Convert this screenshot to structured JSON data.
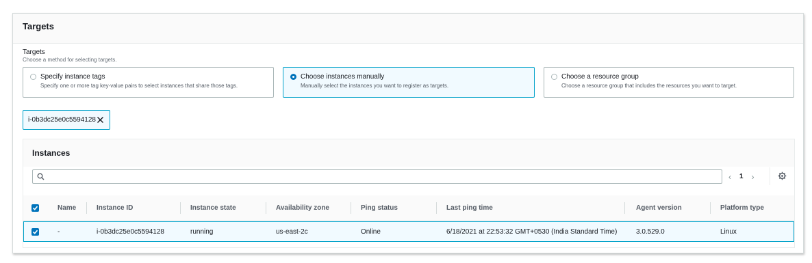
{
  "panel": {
    "title": "Targets"
  },
  "targets_field": {
    "label": "Targets",
    "description": "Choose a method for selecting targets.",
    "options": [
      {
        "title": "Specify instance tags",
        "description": "Specify one or more tag key-value pairs to select instances that share those tags.",
        "selected": false
      },
      {
        "title": "Choose instances manually",
        "description": "Manually select the instances you want to register as targets.",
        "selected": true
      },
      {
        "title": "Choose a resource group",
        "description": "Choose a resource group that includes the resources you want to target.",
        "selected": false
      }
    ]
  },
  "selected_token": {
    "label": "i-0b3dc25e0c5594128"
  },
  "instances": {
    "title": "Instances",
    "search": {
      "value": "",
      "placeholder": ""
    },
    "pagination": {
      "page": "1",
      "prev": "‹",
      "next": "›"
    },
    "columns": [
      "Name",
      "Instance ID",
      "Instance state",
      "Availability zone",
      "Ping status",
      "Last ping time",
      "Agent version",
      "Platform type"
    ],
    "rows": [
      {
        "selected": true,
        "cells": [
          "-",
          "i-0b3dc25e0c5594128",
          "running",
          "us-east-2c",
          "Online",
          "6/18/2021 at 22:53:32 GMT+0530 (India Standard Time)",
          "3.0.529.0",
          "Linux"
        ]
      }
    ]
  },
  "colors": {
    "accent": "#0073bb",
    "selected_border": "#00a1c9",
    "selected_bg": "#f1faff"
  }
}
